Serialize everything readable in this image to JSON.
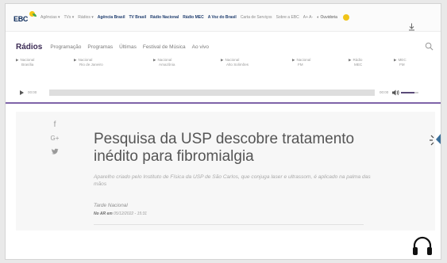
{
  "topbar": {
    "logo": "EBC",
    "items": [
      {
        "label": "Agências ▾",
        "style": "muted"
      },
      {
        "label": "TVs ▾",
        "style": "muted"
      },
      {
        "label": "Rádios ▾",
        "style": "muted"
      },
      {
        "label": "Agência Brasil",
        "style": "strong"
      },
      {
        "label": "TV Brasil",
        "style": "strong"
      },
      {
        "label": "Rádio Nacional",
        "style": "strong"
      },
      {
        "label": "Rádio MEC",
        "style": "strong"
      },
      {
        "label": "A Voz do Brasil",
        "style": "strong"
      },
      {
        "label": "Carta de Serviços",
        "style": "muted"
      },
      {
        "label": "Sobre a EBC",
        "style": "muted"
      },
      {
        "label": "A+ A-",
        "style": "muted"
      },
      {
        "label": "◐ Ouvidoria",
        "style": "normal"
      }
    ]
  },
  "radios_nav": {
    "title": "Rádios",
    "items": [
      "Programação",
      "Programas",
      "Últimas",
      "Festival de Música",
      "Ao vivo"
    ]
  },
  "stations": [
    {
      "line1": "Nacional",
      "line2": "Brasília"
    },
    {
      "line1": "Nacional",
      "line2": "Rio de Janeiro"
    },
    {
      "line1": "Nacional",
      "line2": "Amazônia"
    },
    {
      "line1": "Nacional",
      "line2": "Alto Solimões"
    },
    {
      "line1": "Nacional",
      "line2": "FM"
    },
    {
      "line1": "Rádio",
      "line2": "MEC"
    },
    {
      "line1": "MEC",
      "line2": "FM"
    }
  ],
  "player": {
    "time_current": "00:00",
    "time_total": "00:00",
    "volume_level": 0.75,
    "accent": "#7e63a8"
  },
  "article": {
    "share_icons": [
      "facebook-icon",
      "google-plus-icon",
      "twitter-icon"
    ],
    "share_glyphs": [
      "f",
      "G+",
      "t"
    ],
    "headline": "Pesquisa da USP descobre tratamento inédito para fibromialgia",
    "subtitle": "Aparelho criado pelo Instituto de Física da USP de São Carlos, que conjuga laser e ultrassom, é aplicado na palma das mãos",
    "program": "Tarde Nacional",
    "date_prefix": "No AR em",
    "date": "05/12/2022 - 15:31"
  }
}
